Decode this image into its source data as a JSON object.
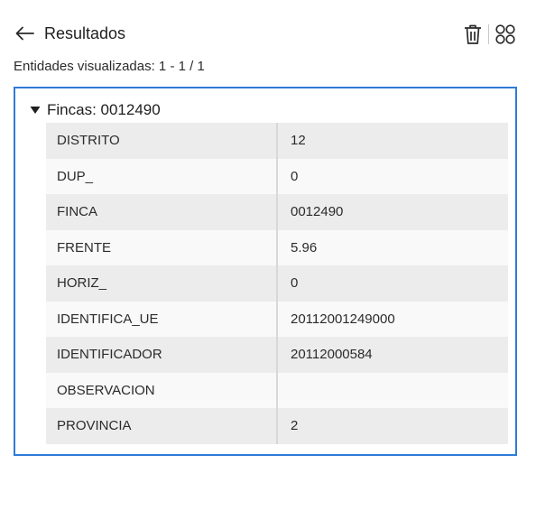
{
  "header": {
    "title": "Resultados",
    "back_icon": "arrow-left-icon",
    "delete_icon": "trash-icon",
    "layout_icon": "grid-circles-icon"
  },
  "summary": "Entidades visualizadas: 1 - 1 / 1",
  "colors": {
    "accent": "#2f7bd8",
    "row_odd": "#ececec",
    "row_even": "#f9f9f9"
  },
  "group": {
    "title": "Fincas: 0012490",
    "expanded": true,
    "rows": [
      {
        "field": "DISTRITO",
        "value": "12"
      },
      {
        "field": "DUP_",
        "value": "0"
      },
      {
        "field": "FINCA",
        "value": "0012490"
      },
      {
        "field": "FRENTE",
        "value": "5.96"
      },
      {
        "field": "HORIZ_",
        "value": "0"
      },
      {
        "field": "IDENTIFICA_UE",
        "value": "20112001249000"
      },
      {
        "field": "IDENTIFICADOR",
        "value": "20112000584"
      },
      {
        "field": "OBSERVACION",
        "value": ""
      },
      {
        "field": "PROVINCIA",
        "value": "2"
      }
    ]
  }
}
